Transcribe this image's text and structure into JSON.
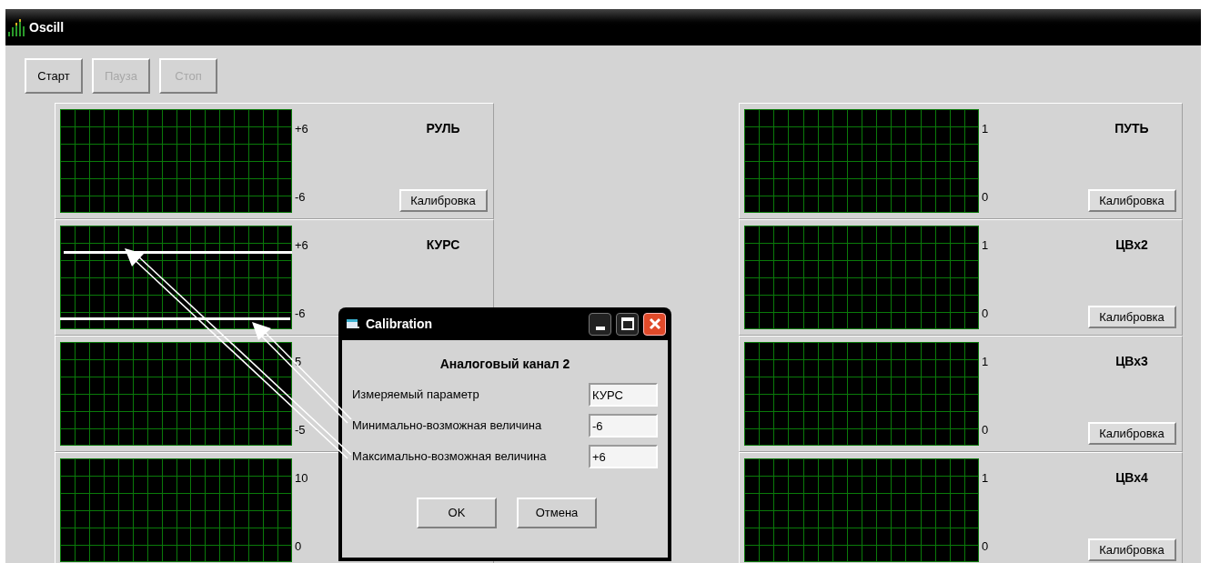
{
  "window": {
    "title": "Oscill"
  },
  "toolbar": [
    {
      "label": "Старт",
      "disabled": false
    },
    {
      "label": "Пауза",
      "disabled": true
    },
    {
      "label": "Стоп",
      "disabled": true
    }
  ],
  "left_channels": [
    {
      "title": "РУЛЬ",
      "max": "+6",
      "min": "-6",
      "button": "Калибровка",
      "show_limits": false
    },
    {
      "title": "КУРС",
      "max": "+6",
      "min": "-6",
      "show_limits": true
    },
    {
      "max": "5",
      "min": "-5",
      "show_limits": false
    },
    {
      "max": "10",
      "min": "0",
      "show_limits": false
    }
  ],
  "right_channels": [
    {
      "title": "ПУТЬ",
      "max": "1",
      "min": "0",
      "button": "Калибровка",
      "show_limits": false
    },
    {
      "title": "ЦВх2",
      "max": "1",
      "min": "0",
      "button": "Калибровка",
      "show_limits": false
    },
    {
      "title": "ЦВх3",
      "max": "1",
      "min": "0",
      "button": "Калибровка",
      "show_limits": false
    },
    {
      "title": "ЦВх4",
      "max": "1",
      "min": "0",
      "button": "Калибровка",
      "show_limits": false
    }
  ],
  "dialog": {
    "title": "Calibration",
    "heading": "Аналоговый канал 2",
    "fields": [
      {
        "label": "Измеряемый параметр",
        "value": "КУРС"
      },
      {
        "label": "Минимально-возможная величина",
        "value": "-6"
      },
      {
        "label": "Максимально-возможная величина",
        "value": "+6"
      }
    ],
    "buttons": [
      "OK",
      "Отмена"
    ]
  }
}
